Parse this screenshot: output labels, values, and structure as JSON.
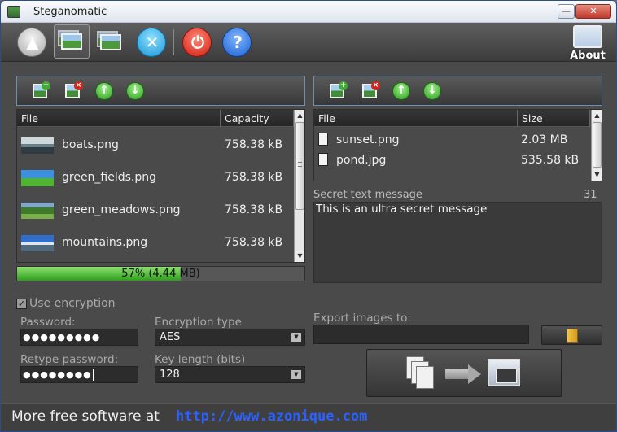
{
  "window": {
    "title": "Steganomatic",
    "min_label": "—",
    "close_label": "✕"
  },
  "toolbar": {
    "eject_glyph": "▲",
    "cancel_glyph": "✕",
    "power_glyph": "⏻",
    "help_glyph": "?",
    "about_label": "About"
  },
  "left_panel": {
    "columns": [
      "File",
      "Capacity"
    ],
    "rows": [
      {
        "name": "boats.png",
        "capacity": "758.38 kB"
      },
      {
        "name": "green_fields.png",
        "capacity": "758.38 kB"
      },
      {
        "name": "green_meadows.png",
        "capacity": "758.38 kB"
      },
      {
        "name": "mountains.png",
        "capacity": "758.38 kB"
      }
    ]
  },
  "progress": {
    "percent": 57,
    "text": "57% (4.44 MB)"
  },
  "right_panel": {
    "columns": [
      "File",
      "Size"
    ],
    "rows": [
      {
        "name": "sunset.png",
        "size": "2.03 MB"
      },
      {
        "name": "pond.jpg",
        "size": "535.58 kB"
      }
    ]
  },
  "secret": {
    "label": "Secret text message",
    "count": "31",
    "text": "This is an ultra secret message"
  },
  "form": {
    "use_encryption_label": "Use encryption",
    "use_encryption_checked": true,
    "password_label": "Password:",
    "password_value": "●●●●●●●●●",
    "retype_label": "Retype password:",
    "retype_value": "●●●●●●●●",
    "enc_type_label": "Encryption type",
    "enc_type_value": "AES",
    "key_length_label": "Key length (bits)",
    "key_length_value": "128",
    "export_label": "Export images to:",
    "export_value": ""
  },
  "footer": {
    "text": "More free software at",
    "link": "http://www.azonique.com"
  }
}
